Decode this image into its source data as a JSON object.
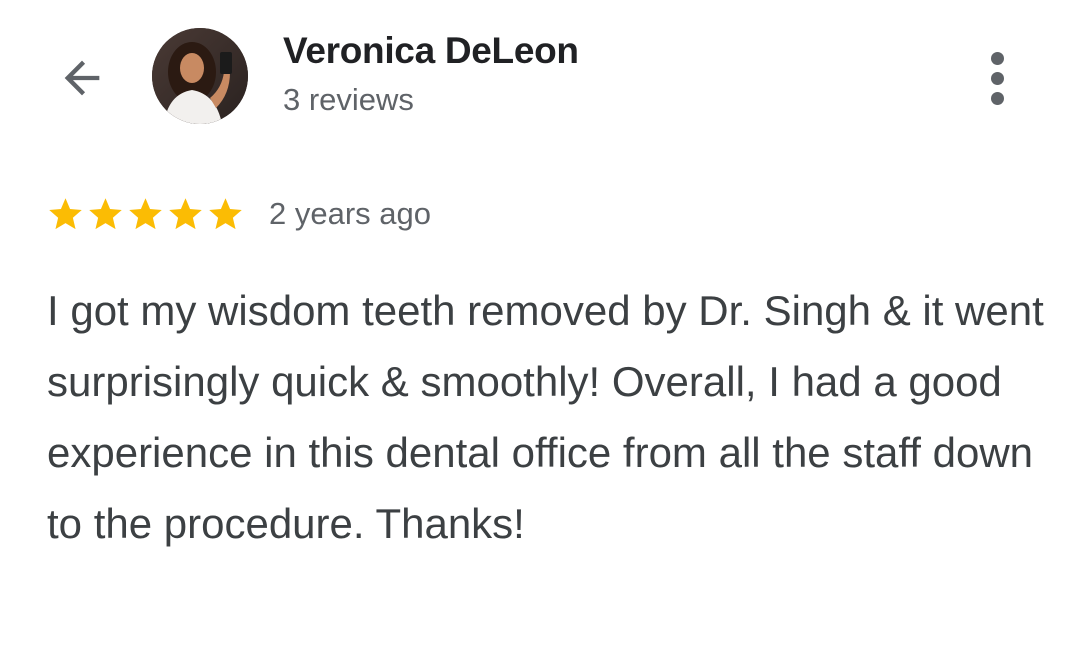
{
  "header": {
    "back_icon": "arrow-back-icon",
    "avatar_alt": "Veronica DeLeon profile photo",
    "name": "Veronica DeLeon",
    "review_count": "3 reviews",
    "menu_icon": "more-vert-icon"
  },
  "review": {
    "rating": 5,
    "rating_max": 5,
    "star_color": "#fbbc04",
    "time_ago": "2 years ago",
    "text": "I got my wisdom teeth removed by Dr. Singh & it went surprisingly quick & smoothly! Overall, I had a good experience in this dental office from all the staff down to the procedure. Thanks!"
  }
}
